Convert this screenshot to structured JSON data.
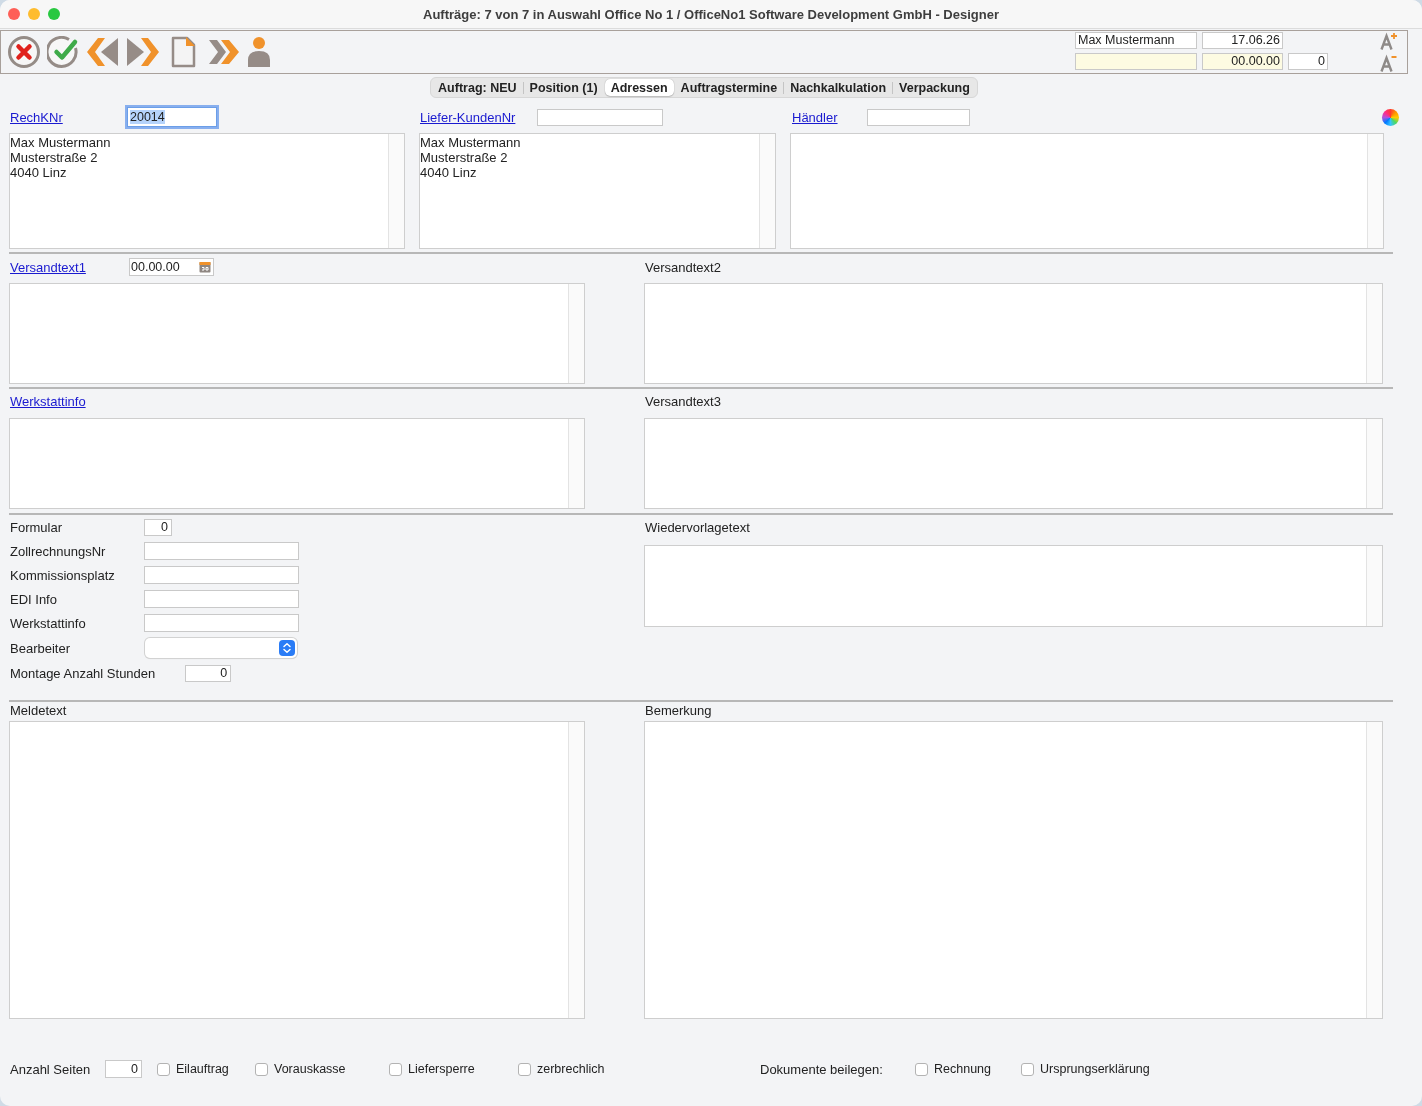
{
  "window": {
    "title": "Aufträge: 7 von 7 in Auswahl Office No 1 / OfficeNo1 Software Development GmbH - Designer"
  },
  "header": {
    "user": "Max Mustermann",
    "date": "17.06.26",
    "due_date": "00.00.00",
    "count": "0"
  },
  "tabs": [
    {
      "label": "Auftrag: NEU",
      "selected": false
    },
    {
      "label": "Position (1)",
      "selected": false
    },
    {
      "label": "Adressen",
      "selected": true
    },
    {
      "label": "Auftragstermine",
      "selected": false
    },
    {
      "label": "Nachkalkulation",
      "selected": false
    },
    {
      "label": "Verpackung",
      "selected": false
    }
  ],
  "addresses": [
    {
      "label": "RechKNr",
      "number": "20014",
      "focused": true,
      "address": "Max Mustermann\nMusterstraße 2\n4040 Linz"
    },
    {
      "label": "Liefer-KundenNr",
      "focused": false,
      "address": "Max Mustermann\nMusterstraße 2\n4040 Linz"
    },
    {
      "label": "Händler",
      "focused": false
    }
  ],
  "text_rows": [
    {
      "panels": [
        {
          "label": "Versandtext1",
          "link": true,
          "date": "00.00.00"
        },
        {
          "label": "Versandtext2",
          "link": false
        }
      ]
    },
    {
      "panels": [
        {
          "label": "Werkstattinfo",
          "link": true
        },
        {
          "label": "Versandtext3",
          "link": false
        }
      ]
    }
  ],
  "details": {
    "fields": [
      {
        "label": "Formular",
        "kind": "number",
        "value": "0"
      },
      {
        "label": "ZollrechnungsNr",
        "kind": "text"
      },
      {
        "label": "Kommissionsplatz",
        "kind": "text"
      },
      {
        "label": "EDI Info",
        "kind": "text"
      },
      {
        "label": "Werkstattinfo",
        "kind": "text"
      },
      {
        "label": "Bearbeiter",
        "kind": "select"
      },
      {
        "label": "Montage Anzahl Stunden",
        "kind": "number",
        "value": "0"
      }
    ],
    "notes": {
      "label": "Wiedervorlagetext"
    }
  },
  "remarks": [
    {
      "label": "Meldetext"
    },
    {
      "label": "Bemerkung"
    }
  ],
  "footer": {
    "pages_label": "Anzahl Seiten",
    "pages": "0",
    "options": [
      {
        "label": "Eilauftrag",
        "checked": false
      },
      {
        "label": "Vorauskasse",
        "checked": false
      },
      {
        "label": "Liefersperre",
        "checked": false
      },
      {
        "label": "zerbrechlich",
        "checked": false
      }
    ],
    "documents_label": "Dokumente beilegen:",
    "documents": [
      {
        "label": "Rechnung",
        "checked": false
      },
      {
        "label": "Ursprungserklärung",
        "checked": false
      }
    ]
  }
}
